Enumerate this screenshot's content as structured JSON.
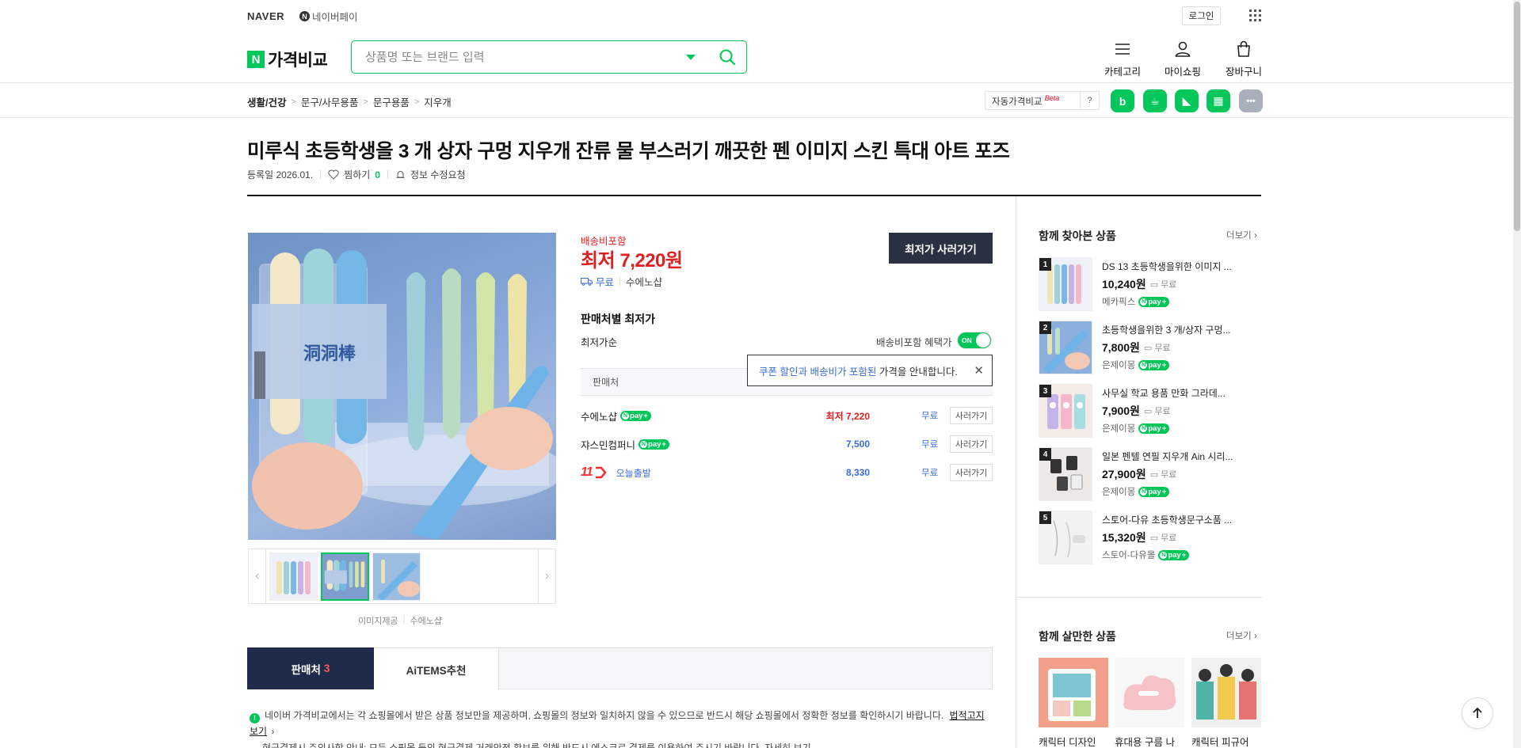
{
  "topbar": {
    "naver": "NAVER",
    "npay": "네이버페이",
    "npay_mark": "N",
    "login": "로그인"
  },
  "header": {
    "brand_mark": "N",
    "brand": "가격비교",
    "search_placeholder": "상품명 또는 브랜드 입력",
    "category": "카테고리",
    "myshopping": "마이쇼핑",
    "cart": "장바구니"
  },
  "breadcrumb": [
    "생활/건강",
    "문구/사무용품",
    "문구용품",
    "지우개"
  ],
  "auto_compare": {
    "label": "자동가격비교",
    "beta": "Beta",
    "help": "?"
  },
  "services": [
    {
      "label": "b",
      "color": "#03c75a"
    },
    {
      "label": "☕",
      "color": "#03c75a"
    },
    {
      "label": "◣",
      "color": "#03c75a"
    },
    {
      "label": "▦",
      "color": "#03c75a"
    },
    {
      "label": "•••",
      "color": "#a9b0bb"
    }
  ],
  "product": {
    "title": "미루식 초등학생을 3 개 상자 구멍 지우개 잔류 물 부스러기 깨끗한 펜 이미지 스킨 특대 아트 포즈",
    "registered": "등록일 2026.01.",
    "wish": "찜하기",
    "wish_count": "0",
    "edit_request": "정보 수정요청",
    "image_credit_label": "이미지제공",
    "image_credit_seller": "수에노샵"
  },
  "price_box": {
    "shipping_included": "배송비포함",
    "lowest_label": "최저",
    "lowest_price": "7,220원",
    "free": "무료",
    "seller": "수에노샵",
    "buy_button": "최저가 사러가기"
  },
  "offers": {
    "section_title": "판매처별 최저가",
    "sort": "최저가순",
    "toggle_label": "배송비포함 혜택가",
    "toggle_state": "ON",
    "table_header": "판매처",
    "tooltip_hl": "쿠폰 할인과 배송비가 포함된",
    "tooltip_rest": " 가격을 안내합니다.",
    "rows": [
      {
        "seller": "수에노샵",
        "price": "최저 7,220",
        "ship": "무료",
        "button": "사러가기"
      },
      {
        "seller": "쟈스민컴퍼니",
        "price": "7,500",
        "ship": "무료",
        "button": "사러가기"
      },
      {
        "seller": "11",
        "tag": "오늘출발",
        "price": "8,330",
        "ship": "무료",
        "button": "사러가기"
      }
    ]
  },
  "npay_badge": "pay",
  "tabs": {
    "sellers": "판매처",
    "sellers_count": "3",
    "aitems": "AiTEMS추천"
  },
  "notice": {
    "text": "네이버 가격비교에서는 각 쇼핑몰에서 받은 상품 정보만을 제공하며, 쇼핑몰의 정보와 일치하지 않을 수 있으므로 반드시 해당 쇼핑몰에서 정확한 정보를 확인하시기 바랍니다.",
    "link": "법적고지 보기",
    "text2": "현금결제시 주의사항 안내: 모든 쇼핑몰 등의 현금결제 거래안전 확보를 위해 반드시 에스크로 결제를 이용하여 주시기 바랍니다. 자세히 보기"
  },
  "sidebar": {
    "viewed_title": "함께 찾아본 상품",
    "more": "더보기",
    "viewed": [
      {
        "rank": "1",
        "name": "DS 13 초등학생을위한 이미지 ...",
        "price": "10,240원",
        "ship": "무료",
        "mall": "메카픽스",
        "npay": true
      },
      {
        "rank": "2",
        "name": "초등학생을위한 3 개/상자 구멍...",
        "price": "7,800원",
        "ship": "무료",
        "mall": "은제이몽",
        "npay": true
      },
      {
        "rank": "3",
        "name": "사무실 학교 용품 만화 그라데...",
        "price": "7,900원",
        "ship": "무료",
        "mall": "은제이몽",
        "npay": true
      },
      {
        "rank": "4",
        "name": "일본 펜텔 연필 지우개 Ain 시리...",
        "price": "27,900원",
        "ship": "무료",
        "mall": "은제이몽",
        "npay": true
      },
      {
        "rank": "5",
        "name": "스토어-다유 초등학생문구소품 ...",
        "price": "15,320원",
        "ship": "무료",
        "mall": "스토어-다유몰",
        "npay": true
      }
    ],
    "together_title": "함께 살만한 상품",
    "together": [
      {
        "name": "캐릭터 디자인"
      },
      {
        "name": "휴대용 구름 나"
      },
      {
        "name": "캐릭터 피규어"
      }
    ]
  }
}
